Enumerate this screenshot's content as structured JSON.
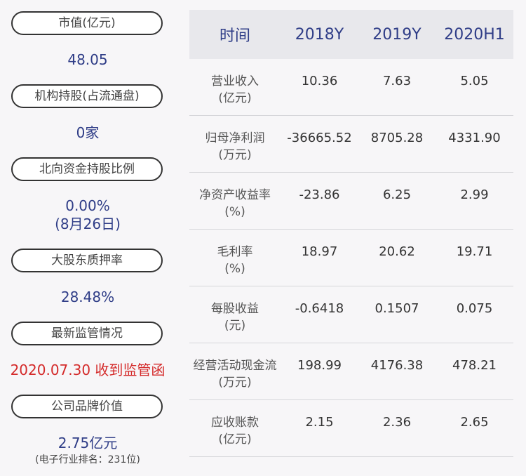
{
  "left": {
    "market_cap": {
      "label": "市值(亿元)",
      "value": "48.05"
    },
    "institution": {
      "label": "机构持股(占流通盘)",
      "value": "0家"
    },
    "northbound": {
      "label": "北向资金持股比例",
      "value": "0.00%",
      "date": "(8月26日)"
    },
    "pledge": {
      "label": "大股东质押率",
      "value": "28.48%"
    },
    "regulation": {
      "label": "最新监管情况",
      "value": "2020.07.30 收到监管函"
    },
    "brand": {
      "label": "公司品牌价值",
      "value": "2.75亿元",
      "rank": "(电子行业排名：231位)"
    }
  },
  "table": {
    "headers": [
      "时间",
      "2018Y",
      "2019Y",
      "2020H1"
    ],
    "rows": [
      {
        "label": "营业收入",
        "unit": "(亿元)",
        "values": [
          "10.36",
          "7.63",
          "5.05"
        ]
      },
      {
        "label": "归母净利润",
        "unit": "(万元)",
        "values": [
          "-36665.52",
          "8705.28",
          "4331.90"
        ]
      },
      {
        "label": "净资产收益率",
        "unit": "(%)",
        "values": [
          "-23.86",
          "6.25",
          "2.99"
        ]
      },
      {
        "label": "毛利率",
        "unit": "(%)",
        "values": [
          "18.97",
          "20.62",
          "19.71"
        ]
      },
      {
        "label": "每股收益",
        "unit": "(元)",
        "values": [
          "-0.6418",
          "0.1507",
          "0.075"
        ]
      },
      {
        "label": "经营活动现金流",
        "unit": "(万元)",
        "values": [
          "198.99",
          "4176.38",
          "478.21"
        ]
      },
      {
        "label": "应收账款",
        "unit": "(亿元)",
        "values": [
          "2.15",
          "2.36",
          "2.65"
        ]
      }
    ]
  },
  "colors": {
    "accent_blue": "#2f3d87",
    "alert_red": "#d42a2a",
    "background": "#f7f6f8",
    "header_bg": "#e8e8ec"
  }
}
